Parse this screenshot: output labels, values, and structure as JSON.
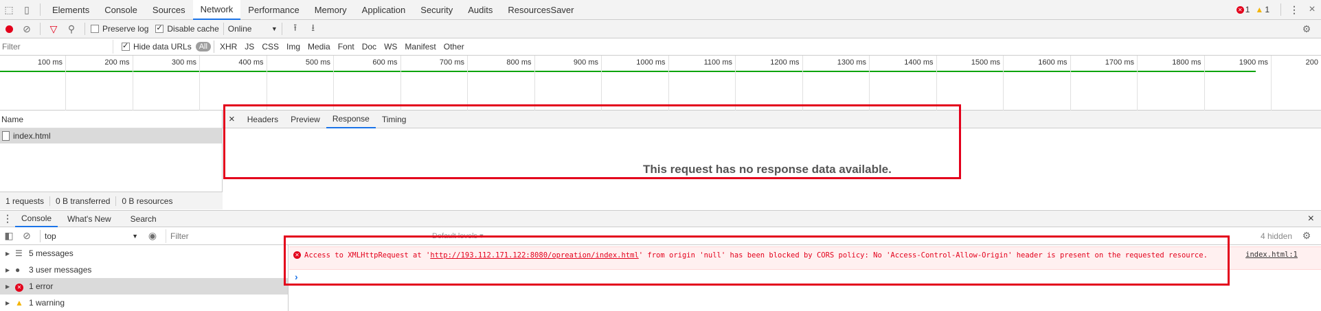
{
  "main_tabs": [
    "Elements",
    "Console",
    "Sources",
    "Network",
    "Performance",
    "Memory",
    "Application",
    "Security",
    "Audits",
    "ResourcesSaver"
  ],
  "badges": {
    "errors": "1",
    "warnings": "1"
  },
  "net_toolbar": {
    "preserve_log": "Preserve log",
    "disable_cache": "Disable cache",
    "throttle": "Online"
  },
  "filter": {
    "placeholder": "Filter",
    "hide_data_urls": "Hide data URLs",
    "types": [
      "All",
      "XHR",
      "JS",
      "CSS",
      "Img",
      "Media",
      "Font",
      "Doc",
      "WS",
      "Manifest",
      "Other"
    ]
  },
  "timeline": {
    "labels": [
      "100 ms",
      "200 ms",
      "300 ms",
      "400 ms",
      "500 ms",
      "600 ms",
      "700 ms",
      "800 ms",
      "900 ms",
      "1000 ms",
      "1100 ms",
      "1200 ms",
      "1300 ms",
      "1400 ms",
      "1500 ms",
      "1600 ms",
      "1700 ms",
      "1800 ms",
      "1900 ms",
      "200"
    ]
  },
  "requests": {
    "header": "Name",
    "file": "index.html",
    "status": [
      "1 requests",
      "0 B transferred",
      "0 B resources"
    ]
  },
  "detail": {
    "close": "×",
    "tabs": [
      "Headers",
      "Preview",
      "Response",
      "Timing"
    ],
    "message": "This request has no response data available."
  },
  "drawer": {
    "tabs": [
      "Console",
      "What's New",
      "Search"
    ],
    "close": "×"
  },
  "console_toolbar": {
    "context": "top",
    "filter_placeholder": "Filter",
    "levels": "Default levels ▾",
    "hidden": "4 hidden"
  },
  "sidebar": [
    "5 messages",
    "3 user messages",
    "1 error",
    "1 warning"
  ],
  "error": {
    "part1": "Access to XMLHttpRequest at '",
    "url": "http://193.112.171.122:8080/opreation/index.html",
    "part2": "' from origin 'null' has been blocked by CORS policy: No 'Access-Control-Allow-Origin' header is present on the requested resource.",
    "source": "index.html:1"
  },
  "prompt": "›"
}
